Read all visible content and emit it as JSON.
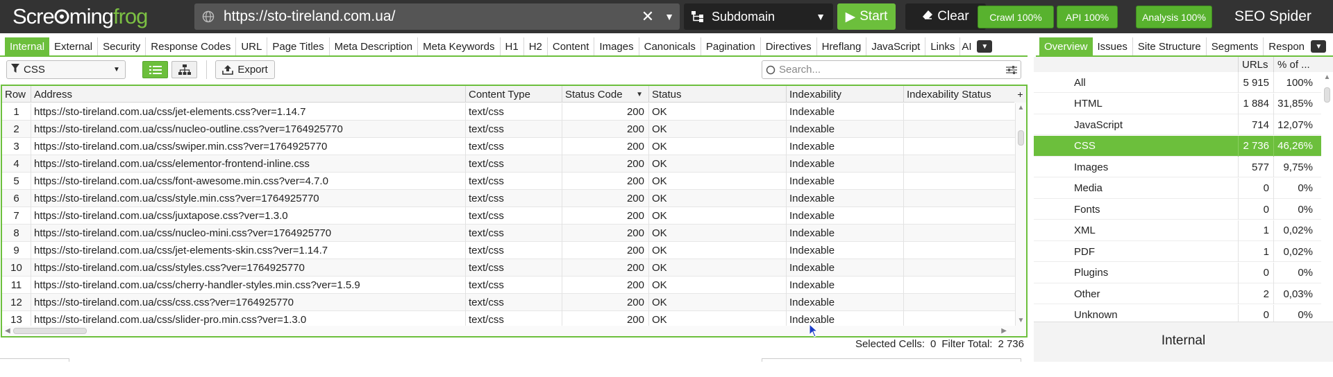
{
  "app": {
    "logo_text": "Screamingfrog",
    "product": "SEO Spider"
  },
  "urlbar": {
    "url": "https://sto-tireland.com.ua/"
  },
  "mode": {
    "label": "Subdomain"
  },
  "buttons": {
    "start": "Start",
    "clear": "Clear",
    "crawl": "Crawl 100%",
    "api": "API 100%",
    "analysis": "Analysis 100%"
  },
  "tabs": [
    "Internal",
    "External",
    "Security",
    "Response Codes",
    "URL",
    "Page Titles",
    "Meta Description",
    "Meta Keywords",
    "H1",
    "H2",
    "Content",
    "Images",
    "Canonicals",
    "Pagination",
    "Directives",
    "Hreflang",
    "JavaScript",
    "Links",
    "AI"
  ],
  "right_tabs": [
    "Overview",
    "Issues",
    "Site Structure",
    "Segments",
    "Respon"
  ],
  "toolbar": {
    "filter": "CSS",
    "export": "Export",
    "search_placeholder": "Search..."
  },
  "table": {
    "columns": [
      "Row",
      "Address",
      "Content Type",
      "Status Code",
      "Status",
      "Indexability",
      "Indexability Status"
    ],
    "rows": [
      [
        "1",
        "https://sto-tireland.com.ua/css/jet-elements.css?ver=1.14.7",
        "text/css",
        "200",
        "OK",
        "Indexable",
        ""
      ],
      [
        "2",
        "https://sto-tireland.com.ua/css/nucleo-outline.css?ver=1764925770",
        "text/css",
        "200",
        "OK",
        "Indexable",
        ""
      ],
      [
        "3",
        "https://sto-tireland.com.ua/css/swiper.min.css?ver=1764925770",
        "text/css",
        "200",
        "OK",
        "Indexable",
        ""
      ],
      [
        "4",
        "https://sto-tireland.com.ua/css/elementor-frontend-inline.css",
        "text/css",
        "200",
        "OK",
        "Indexable",
        ""
      ],
      [
        "5",
        "https://sto-tireland.com.ua/css/font-awesome.min.css?ver=4.7.0",
        "text/css",
        "200",
        "OK",
        "Indexable",
        ""
      ],
      [
        "6",
        "https://sto-tireland.com.ua/css/style.min.css?ver=1764925770",
        "text/css",
        "200",
        "OK",
        "Indexable",
        ""
      ],
      [
        "7",
        "https://sto-tireland.com.ua/css/juxtapose.css?ver=1.3.0",
        "text/css",
        "200",
        "OK",
        "Indexable",
        ""
      ],
      [
        "8",
        "https://sto-tireland.com.ua/css/nucleo-mini.css?ver=1764925770",
        "text/css",
        "200",
        "OK",
        "Indexable",
        ""
      ],
      [
        "9",
        "https://sto-tireland.com.ua/css/jet-elements-skin.css?ver=1.14.7",
        "text/css",
        "200",
        "OK",
        "Indexable",
        ""
      ],
      [
        "10",
        "https://sto-tireland.com.ua/css/styles.css?ver=1764925770",
        "text/css",
        "200",
        "OK",
        "Indexable",
        ""
      ],
      [
        "11",
        "https://sto-tireland.com.ua/css/cherry-handler-styles.min.css?ver=1.5.9",
        "text/css",
        "200",
        "OK",
        "Indexable",
        ""
      ],
      [
        "12",
        "https://sto-tireland.com.ua/css/css.css?ver=1764925770",
        "text/css",
        "200",
        "OK",
        "Indexable",
        ""
      ],
      [
        "13",
        "https://sto-tireland.com.ua/css/slider-pro.min.css?ver=1.3.0",
        "text/css",
        "200",
        "OK",
        "Indexable",
        ""
      ]
    ]
  },
  "status": {
    "selected_label": "Selected Cells:",
    "selected_value": "0",
    "filter_label": "Filter Total:",
    "filter_value": "2 736"
  },
  "overview": {
    "columns": [
      "URLs",
      "% of ..."
    ],
    "rows": [
      {
        "name": "All",
        "urls": "5 915",
        "pct": "100%"
      },
      {
        "name": "HTML",
        "urls": "1 884",
        "pct": "31,85%"
      },
      {
        "name": "JavaScript",
        "urls": "714",
        "pct": "12,07%"
      },
      {
        "name": "CSS",
        "urls": "2 736",
        "pct": "46,26%",
        "selected": true
      },
      {
        "name": "Images",
        "urls": "577",
        "pct": "9,75%"
      },
      {
        "name": "Media",
        "urls": "0",
        "pct": "0%"
      },
      {
        "name": "Fonts",
        "urls": "0",
        "pct": "0%"
      },
      {
        "name": "XML",
        "urls": "1",
        "pct": "0,02%"
      },
      {
        "name": "PDF",
        "urls": "1",
        "pct": "0,02%"
      },
      {
        "name": "Plugins",
        "urls": "0",
        "pct": "0%"
      },
      {
        "name": "Other",
        "urls": "2",
        "pct": "0,03%"
      },
      {
        "name": "Unknown",
        "urls": "0",
        "pct": "0%"
      }
    ],
    "section_title": "Internal"
  },
  "colors": {
    "accent": "#6cbf3c",
    "topbar": "#333333"
  }
}
